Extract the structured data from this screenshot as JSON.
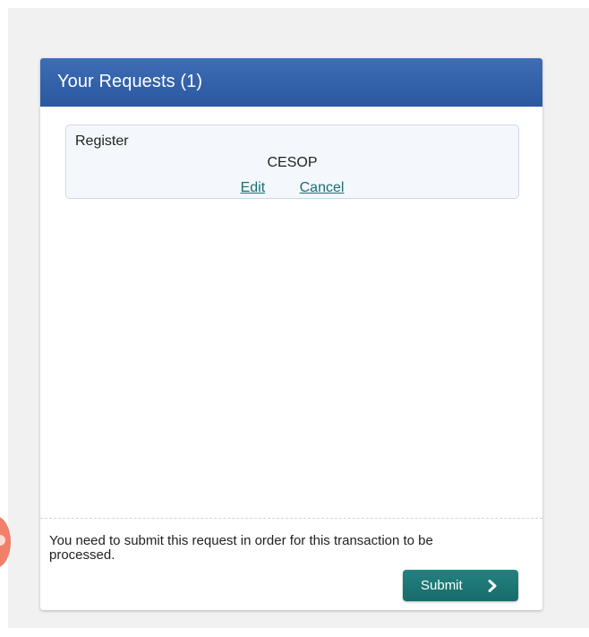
{
  "panel": {
    "title": "Your Requests (1)"
  },
  "requests": [
    {
      "type": "Register",
      "name": "CESOP",
      "edit_label": "Edit",
      "cancel_label": "Cancel"
    }
  ],
  "footer": {
    "message": "You need to submit this request in order for this transaction to be processed.",
    "submit_label": "Submit",
    "submit_icon": "chevron-right-icon"
  },
  "colors": {
    "header": "#2f5ea7",
    "submit": "#1c7472",
    "link": "#1b6f73",
    "card_bg": "#f4f8fc",
    "badge": "#f0725a"
  }
}
